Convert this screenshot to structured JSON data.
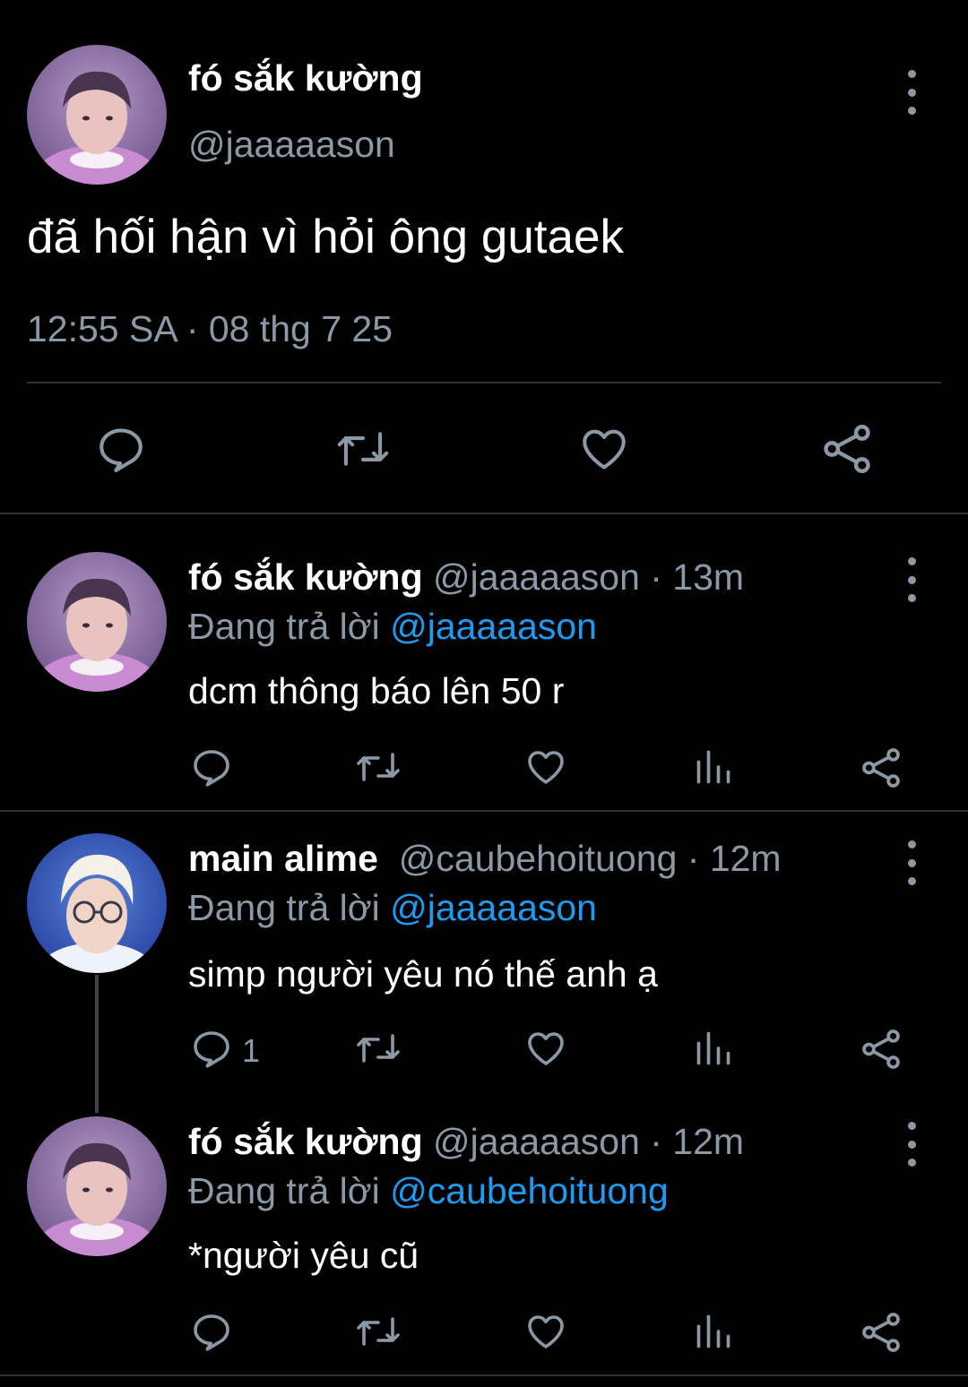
{
  "main_tweet": {
    "name": "fó sắk kường",
    "handle": "@jaaaaason",
    "text": "đã hối hận vì hỏi ông gutaek",
    "timestamp": "12:55 SA · 08 thg 7 25"
  },
  "replies": [
    {
      "name": "fó sắk kường",
      "meta": "@jaaaaason · 13m",
      "replying_prefix": "Đang trả lời ",
      "replying_to": "@jaaaaason",
      "text": "dcm thông báo lên 50 r",
      "reply_count": ""
    },
    {
      "name": "main alime",
      "meta": "@caubehoituong · 12m",
      "replying_prefix": "Đang trả lời ",
      "replying_to": "@jaaaaason",
      "text": "simp người yêu nó thế anh ạ",
      "reply_count": "1"
    },
    {
      "name": "fó sắk kường",
      "meta": "@jaaaaason · 12m",
      "replying_prefix": "Đang trả lời ",
      "replying_to": "@caubehoituong",
      "text": "*người yêu cũ",
      "reply_count": ""
    }
  ],
  "icons": {
    "reply": "reply-bubble-icon",
    "retweet": "retweet-icon",
    "like": "heart-icon",
    "views": "bar-chart-icon",
    "share": "share-icon",
    "more": "more-vertical-icon"
  },
  "colors": {
    "background": "#000000",
    "primary_text": "#ffffff",
    "secondary_text": "#8b98a5",
    "mention": "#1d9bf0",
    "divider": "#2f3336"
  }
}
